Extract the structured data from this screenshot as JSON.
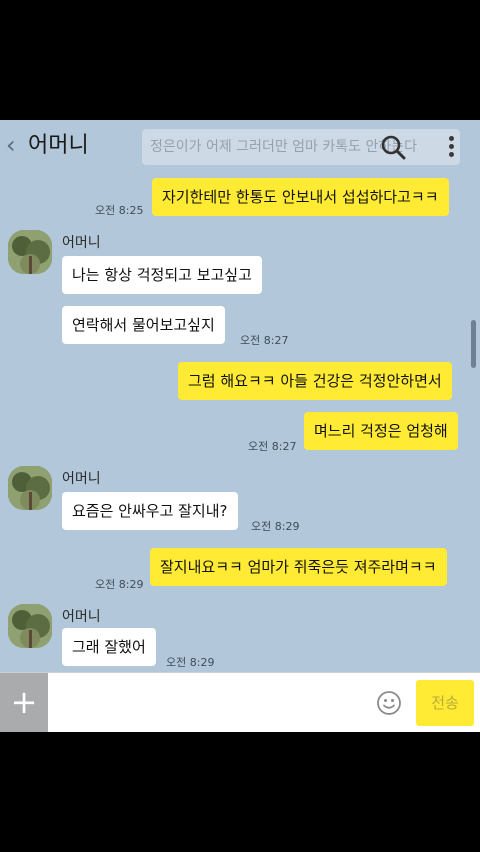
{
  "header": {
    "back_icon": "chevron-left-icon",
    "title": "어머니",
    "search_preview": "정은이가 어제 그러더만 엄마 카톡도 안하는다",
    "search_icon": "search-icon",
    "more_icon": "more-vertical-icon"
  },
  "messages": [
    {
      "side": "mine",
      "text": "자기한테만 한통도 안보내서 섭섭하다고ㅋㅋ",
      "time": "오전 8:25"
    },
    {
      "side": "theirs",
      "sender": "어머니",
      "lines": [
        "나는 항상 걱정되고 보고싶고",
        "연락해서 물어보고싶지"
      ],
      "time": "오전 8:27"
    },
    {
      "side": "mine",
      "lines": [
        "그럼 해요ㅋㅋ 아들 건강은 걱정안하면서",
        "며느리 걱정은 엄청해"
      ],
      "time": "오전 8:27"
    },
    {
      "side": "theirs",
      "sender": "어머니",
      "text": "요즘은 안싸우고 잘지내?",
      "time": "오전 8:29"
    },
    {
      "side": "mine",
      "text": "잘지내요ㅋㅋ 엄마가 쥐죽은듯 져주라며ㅋㅋ",
      "time": "오전 8:29"
    },
    {
      "side": "theirs",
      "sender": "어머니",
      "text": "그래 잘했어",
      "time": "오전 8:29"
    }
  ],
  "input": {
    "plus_icon": "plus-icon",
    "placeholder": "",
    "emoji_icon": "emoji-icon",
    "send_label": "전송"
  },
  "colors": {
    "background": "#b2c7d9",
    "my_bubble": "#ffeb33",
    "their_bubble": "#ffffff"
  }
}
